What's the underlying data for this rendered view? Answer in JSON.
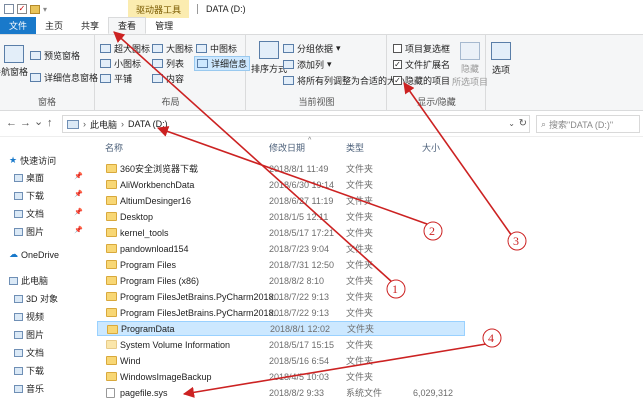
{
  "titlebar": {
    "context_tab": "驱动器工具",
    "window_title": "DATA (D:)"
  },
  "tabs": [
    {
      "label": "文件"
    },
    {
      "label": "主页"
    },
    {
      "label": "共享"
    },
    {
      "label": "查看"
    },
    {
      "label": "管理"
    }
  ],
  "ribbon": {
    "pane": {
      "nav_pane": "导航窗格",
      "preview": "预览窗格",
      "details": "详细信息窗格",
      "label": "窗格"
    },
    "layout": {
      "xl_icons": "超大图标",
      "large_icons": "大图标",
      "medium_icons": "中图标",
      "small_icons": "小图标",
      "list": "列表",
      "details": "详细信息",
      "tiles": "平铺",
      "content": "内容",
      "label": "布局"
    },
    "current_view": {
      "sort_by": "排序方式",
      "group_by": "分组依据",
      "add_column": "添加列",
      "fit_columns": "将所有列调整为合适的大小",
      "label": "当前视图"
    },
    "show_hide": {
      "item_checkboxes": "项目复选框",
      "item_checkboxes_checked": false,
      "file_extensions": "文件扩展名",
      "file_extensions_checked": true,
      "hidden_items": "隐藏的项目",
      "hidden_items_checked": true,
      "hide_selected": "隐藏",
      "hide_selected_2": "所选项目",
      "label": "显示/隐藏"
    },
    "options": "选项"
  },
  "nav": {
    "back": "←",
    "forward": "→",
    "recent": "⌄",
    "up": "↑",
    "breadcrumb": [
      "此电脑",
      "DATA (D:)"
    ],
    "search_placeholder": "搜索\"DATA (D:)\""
  },
  "navpane": [
    {
      "label": "快速访问",
      "icon": "star-icon"
    },
    {
      "label": "桌面",
      "icon": "desktop-icon",
      "pinned": true
    },
    {
      "label": "下载",
      "icon": "download-icon",
      "pinned": true
    },
    {
      "label": "文档",
      "icon": "document-icon",
      "pinned": true
    },
    {
      "label": "图片",
      "icon": "picture-icon",
      "pinned": true
    },
    {
      "label": "OneDrive",
      "icon": "cloud-icon"
    },
    {
      "label": "此电脑",
      "icon": "computer-icon"
    },
    {
      "label": "3D 对象",
      "icon": "cube-icon"
    },
    {
      "label": "视频",
      "icon": "video-icon"
    },
    {
      "label": "图片",
      "icon": "picture-icon"
    },
    {
      "label": "文档",
      "icon": "document-icon"
    },
    {
      "label": "下载",
      "icon": "download-icon"
    },
    {
      "label": "音乐",
      "icon": "music-icon"
    }
  ],
  "columns": {
    "name": "名称",
    "date": "修改日期",
    "type": "类型",
    "size": "大小"
  },
  "files": [
    {
      "name": "360安全浏览器下载",
      "date": "2018/8/1 11:49",
      "type": "文件夹",
      "size": ""
    },
    {
      "name": "AliWorkbenchData",
      "date": "2018/6/30 19:14",
      "type": "文件夹",
      "size": ""
    },
    {
      "name": "AltiumDesinger16",
      "date": "2018/6/27 11:19",
      "type": "文件夹",
      "size": ""
    },
    {
      "name": "Desktop",
      "date": "2018/1/5 12:11",
      "type": "文件夹",
      "size": ""
    },
    {
      "name": "kernel_tools",
      "date": "2018/5/17 17:21",
      "type": "文件夹",
      "size": ""
    },
    {
      "name": "pandownload154",
      "date": "2018/7/23 9:04",
      "type": "文件夹",
      "size": ""
    },
    {
      "name": "Program Files",
      "date": "2018/7/31 12:50",
      "type": "文件夹",
      "size": ""
    },
    {
      "name": "Program Files (x86)",
      "date": "2018/8/2 8:10",
      "type": "文件夹",
      "size": ""
    },
    {
      "name": "Program FilesJetBrains.PyCharm2018...",
      "date": "2018/7/22 9:13",
      "type": "文件夹",
      "size": ""
    },
    {
      "name": "Program FilesJetBrains.PyCharm2018...",
      "date": "2018/7/22 9:13",
      "type": "文件夹",
      "size": ""
    },
    {
      "name": "ProgramData",
      "date": "2018/8/1 12:02",
      "type": "文件夹",
      "size": "",
      "selected": true
    },
    {
      "name": "System Volume Information",
      "date": "2018/5/17 15:15",
      "type": "文件夹",
      "size": ""
    },
    {
      "name": "Wind",
      "date": "2018/5/16 6:54",
      "type": "文件夹",
      "size": ""
    },
    {
      "name": "WindowsImageBackup",
      "date": "2018/4/5 10:03",
      "type": "文件夹",
      "size": ""
    },
    {
      "name": "pagefile.sys",
      "date": "2018/8/2 9:33",
      "type": "系统文件",
      "size": "6,029,312",
      "system": true
    }
  ],
  "annotations": [
    "1",
    "2",
    "3",
    "4"
  ],
  "colors": {
    "accent": "#1979ca",
    "selection": "#cce8ff",
    "annotation": "#cc2222",
    "context_tab": "#fbecb0"
  }
}
